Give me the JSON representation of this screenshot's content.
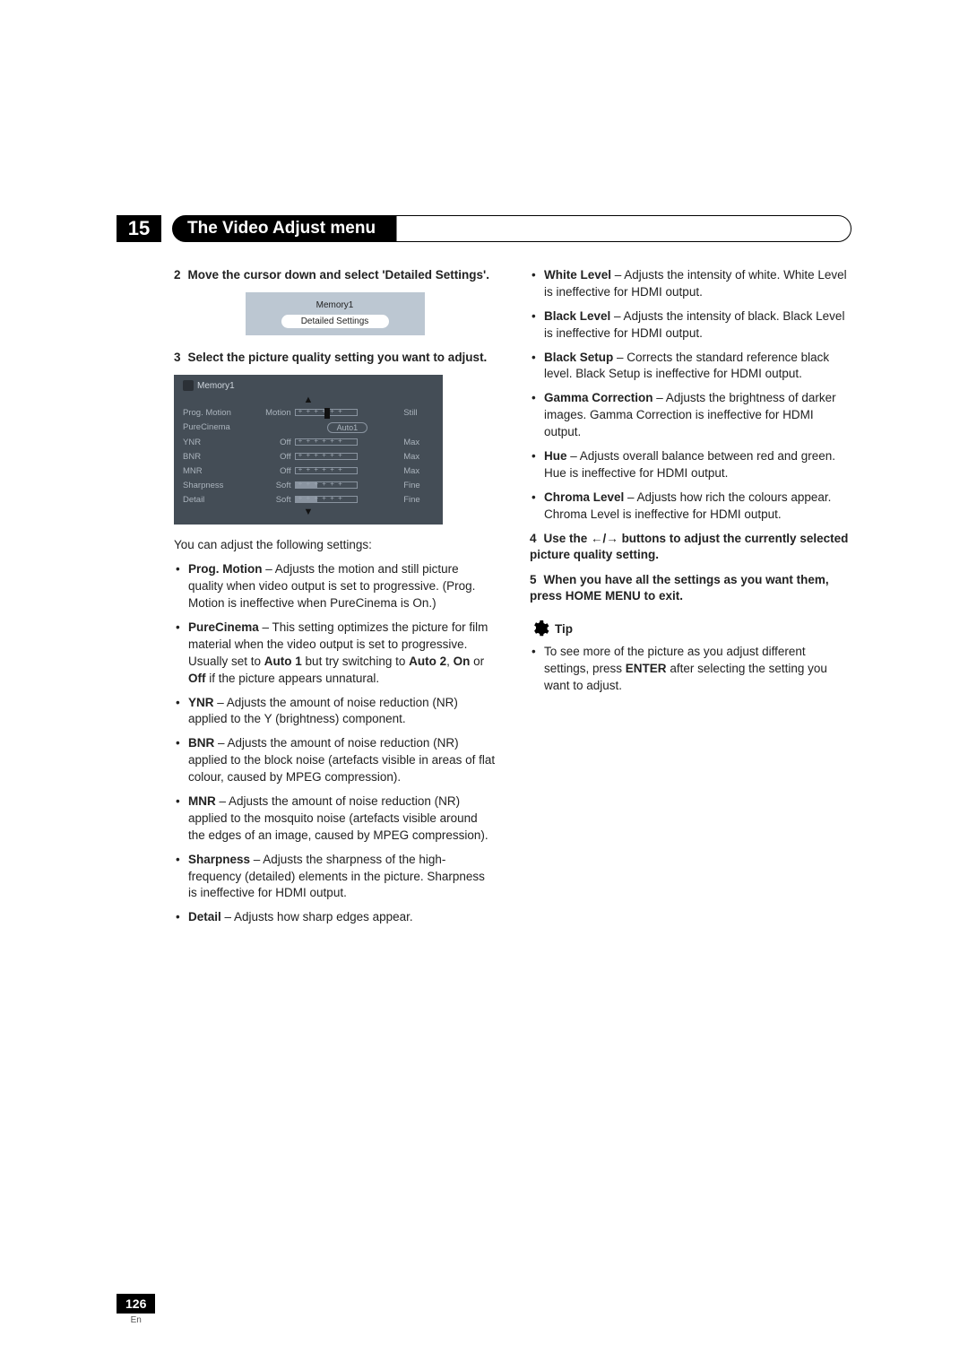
{
  "header": {
    "chapter_number": "15",
    "title": "The Video Adjust menu"
  },
  "left": {
    "step2": {
      "num": "2",
      "text": "Move the cursor down and select 'Detailed Settings'."
    },
    "fig1": {
      "row1": "Memory1",
      "row2": "Detailed Settings"
    },
    "step3": {
      "num": "3",
      "text": "Select the picture quality setting you want to adjust."
    },
    "fig2": {
      "title": "Memory1",
      "rows": [
        {
          "label": "Prog. Motion",
          "left": "Motion",
          "ctrl": "slider_tick_marker",
          "right": "Still"
        },
        {
          "label": "PureCinema",
          "left": "",
          "ctrl": "pill",
          "value": "Auto1",
          "right": ""
        },
        {
          "label": "YNR",
          "left": "Off",
          "ctrl": "slider_tick",
          "right": "Max"
        },
        {
          "label": "BNR",
          "left": "Off",
          "ctrl": "slider_tick",
          "right": "Max"
        },
        {
          "label": "MNR",
          "left": "Off",
          "ctrl": "slider_tick",
          "right": "Max"
        },
        {
          "label": "Sharpness",
          "left": "Soft",
          "ctrl": "slider_fill",
          "right": "Fine"
        },
        {
          "label": "Detail",
          "left": "Soft",
          "ctrl": "slider_fill",
          "right": "Fine"
        }
      ]
    },
    "intro": "You can adjust the following settings:",
    "bullets": [
      {
        "term": "Prog. Motion",
        "desc": " – Adjusts the motion and still picture quality when video output is set to progressive. (Prog. Motion is ineffective when PureCinema is On.)"
      },
      {
        "term": "PureCinema",
        "desc": " – This setting optimizes the picture for film material when the video output is set to progressive. Usually set to ",
        "tail": " if the picture appears unnatural.",
        "mid_strong1": "Auto 1",
        "mid_plain1": " but try switching to ",
        "mid_strong2": "Auto 2",
        "mid_plain2": ", ",
        "mid_strong3": "On",
        "mid_plain3": " or ",
        "mid_strong4": "Off"
      },
      {
        "term": "YNR",
        "desc": " – Adjusts the amount of noise reduction (NR) applied to the Y (brightness) component."
      },
      {
        "term": "BNR",
        "desc": " – Adjusts the amount of noise reduction (NR) applied to the block noise (artefacts visible in areas of flat colour, caused by MPEG compression)."
      },
      {
        "term": "MNR",
        "desc": " – Adjusts the amount of noise reduction (NR) applied to the mosquito noise (artefacts visible around the edges of an image, caused by MPEG compression)."
      },
      {
        "term": "Sharpness",
        "desc": " – Adjusts the sharpness of the high-frequency (detailed) elements in the picture. Sharpness is ineffective for HDMI output."
      },
      {
        "term": "Detail",
        "desc": " – Adjusts how sharp edges appear."
      }
    ]
  },
  "right": {
    "bullets": [
      {
        "term": "White Level",
        "desc": " – Adjusts the intensity of white. White Level is ineffective for HDMI output."
      },
      {
        "term": "Black Level",
        "desc": " – Adjusts the intensity of black. Black Level is ineffective for HDMI output."
      },
      {
        "term": "Black Setup",
        "desc": " – Corrects the standard reference black level. Black Setup is ineffective for HDMI output."
      },
      {
        "term": "Gamma Correction",
        "desc": " – Adjusts the brightness of darker images. Gamma Correction is ineffective for HDMI output."
      },
      {
        "term": "Hue",
        "desc": " – Adjusts overall balance between red and green. Hue is ineffective for HDMI output."
      },
      {
        "term": "Chroma Level",
        "desc": " – Adjusts how rich the colours appear. Chroma Level is ineffective for HDMI output."
      }
    ],
    "step4": {
      "num": "4",
      "pre": "Use the ",
      "arrows": "←/→",
      "post": " buttons to adjust the currently selected picture quality setting."
    },
    "step5": {
      "num": "5",
      "text": "When you have all the settings as you want them, press HOME MENU to exit."
    },
    "tip_label": "Tip",
    "tip_bullet_pre": "To see more of the picture as you adjust different settings, press ",
    "tip_bullet_strong": "ENTER",
    "tip_bullet_post": " after selecting the setting you want to adjust."
  },
  "footer": {
    "page": "126",
    "lang": "En"
  }
}
